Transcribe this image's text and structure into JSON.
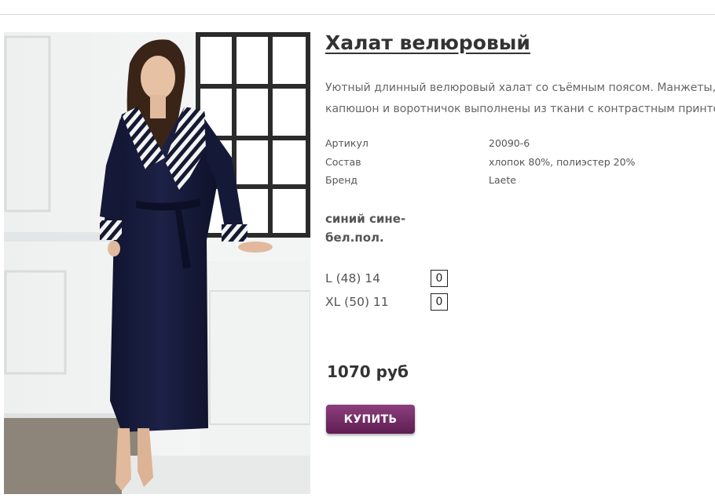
{
  "product": {
    "title": "Халат велюровый",
    "description_lines": [
      "Уютный длинный велюровый халат со съёмным поясом. Манжеты,",
      "капюшон и воротничок выполнены из ткани с контрастным принтом"
    ],
    "specs": [
      {
        "label": "Артикул",
        "value": "20090-6"
      },
      {
        "label": "Состав",
        "value": "хлопок 80%, полиэстер 20%"
      },
      {
        "label": "Бренд",
        "value": "Laete"
      }
    ],
    "color_lines": [
      "синий сине-",
      "бел.пол."
    ],
    "sizes": [
      {
        "label": "L (48)   14",
        "qty": "0"
      },
      {
        "label": "XL (50)   11",
        "qty": "0"
      }
    ],
    "price": "1070 руб",
    "buy_label": "КУПИТЬ",
    "accent_color": "#6e2a62"
  }
}
